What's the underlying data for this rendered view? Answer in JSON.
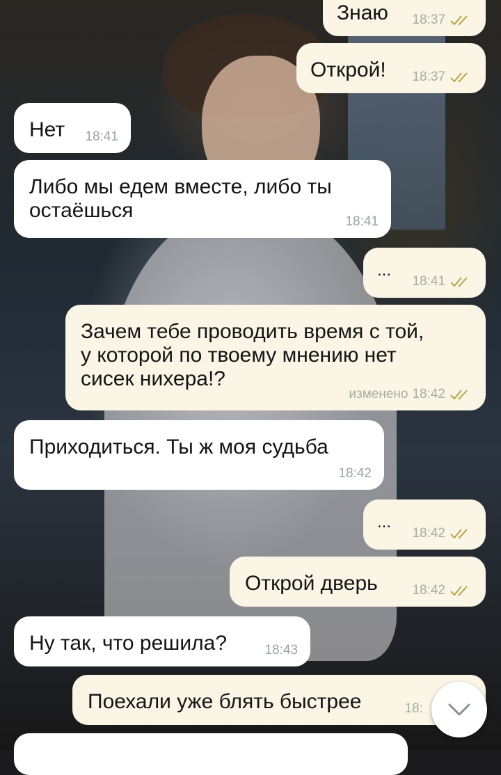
{
  "messages": [
    {
      "text": "Знаю",
      "time": "18:37",
      "dir": "out"
    },
    {
      "text": "Открой!",
      "time": "18:37",
      "dir": "out"
    },
    {
      "text": "Нет",
      "time": "18:41",
      "dir": "in"
    },
    {
      "text": "Либо мы едем вместе, либо ты\nостаёшься",
      "time": "18:41",
      "dir": "in"
    },
    {
      "text": "...",
      "time": "18:41",
      "dir": "out"
    },
    {
      "text": "Зачем тебе проводить время с той,\nу которой по твоему мнению нет\nсисек нихера!?",
      "time": "18:42",
      "edited_label": "изменено",
      "dir": "out"
    },
    {
      "text": "Приходиться. Ты ж моя судьба",
      "time": "18:42",
      "dir": "in"
    },
    {
      "text": "...",
      "time": "18:42",
      "dir": "out"
    },
    {
      "text": "Открой дверь",
      "time": "18:42",
      "dir": "out"
    },
    {
      "text": "Ну так, что решила?",
      "time": "18:43",
      "dir": "in"
    },
    {
      "text": "Поехали уже блять быстрее",
      "time": "18:",
      "dir": "out"
    }
  ],
  "colors": {
    "incoming_bubble": "#ffffff",
    "outgoing_bubble": "#fbf5e6",
    "read_checks": "#b9a24a",
    "meta_text": "#9aa3a8"
  },
  "icons": {
    "read_status": "double-check-icon",
    "scroll_down": "chevron-down-icon"
  }
}
